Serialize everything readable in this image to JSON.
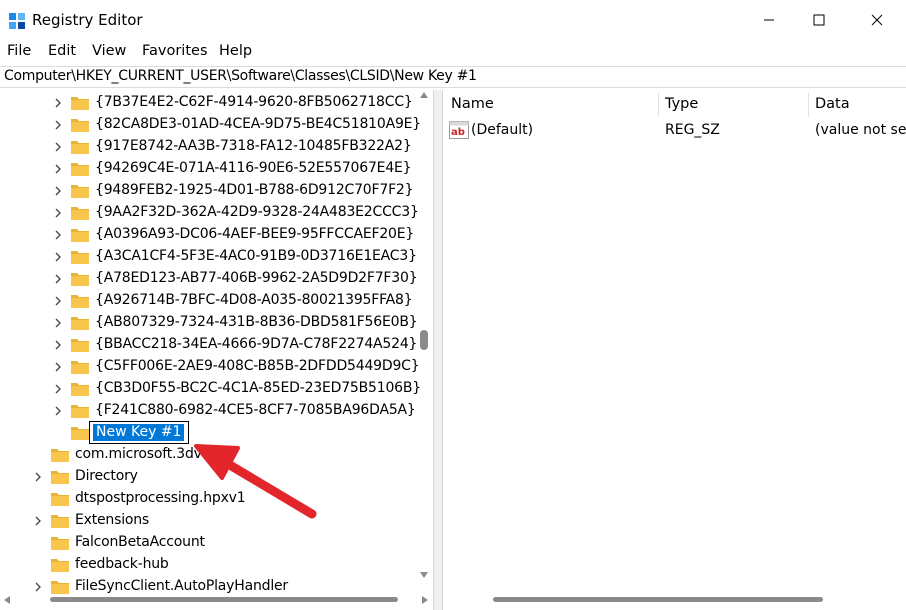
{
  "window": {
    "title": "Registry Editor",
    "icons": {
      "app": "regedit-icon",
      "minimize": "minimize-icon",
      "maximize": "maximize-icon",
      "close": "close-icon"
    }
  },
  "menu": [
    "File",
    "Edit",
    "View",
    "Favorites",
    "Help"
  ],
  "address": "Computer\\HKEY_CURRENT_USER\\Software\\Classes\\CLSID\\New Key #1",
  "tree": {
    "clsid_children": [
      "{7B37E4E2-C62F-4914-9620-8FB5062718CC}",
      "{82CA8DE3-01AD-4CEA-9D75-BE4C51810A9E}",
      "{917E8742-AA3B-7318-FA12-10485FB322A2}",
      "{94269C4E-071A-4116-90E6-52E557067E4E}",
      "{9489FEB2-1925-4D01-B788-6D912C70F7F2}",
      "{9AA2F32D-362A-42D9-9328-24A483E2CCC3}",
      "{A0396A93-DC06-4AEF-BEE9-95FFCCAEF20E}",
      "{A3CA1CF4-5F3E-4AC0-91B9-0D3716E1EAC3}",
      "{A78ED123-AB77-406B-9962-2A5D9D2F7F30}",
      "{A926714B-7BFC-4D08-A035-80021395FFA8}",
      "{AB807329-7324-431B-8B36-DBD581F56E0B}",
      "{BBACC218-34EA-4666-9D7A-C78F2274A524}",
      "{C5FF006E-2AE9-408C-B85B-2DFDD5449D9C}",
      "{CB3D0F55-BC2C-4C1A-85ED-23ED75B5106B}",
      "{F241C880-6982-4CE5-8CF7-7085BA96DA5A}"
    ],
    "new_key": "New Key #1",
    "siblings": [
      {
        "label": "com.microsoft.3dvie",
        "expandable": false
      },
      {
        "label": "Directory",
        "expandable": true
      },
      {
        "label": "dtspostprocessing.hpxv1",
        "expandable": false
      },
      {
        "label": "Extensions",
        "expandable": true
      },
      {
        "label": "FalconBetaAccount",
        "expandable": false
      },
      {
        "label": "feedback-hub",
        "expandable": false
      },
      {
        "label": "FileSyncClient.AutoPlayHandler",
        "expandable": true
      }
    ]
  },
  "values": {
    "columns": [
      "Name",
      "Type",
      "Data"
    ],
    "rows": [
      {
        "icon": "reg-sz-icon",
        "name": "(Default)",
        "type": "REG_SZ",
        "data": "(value not set)"
      }
    ]
  },
  "colors": {
    "selection": "#0078d7",
    "folder": "#f8c64c",
    "arrow": "#e3262c"
  }
}
